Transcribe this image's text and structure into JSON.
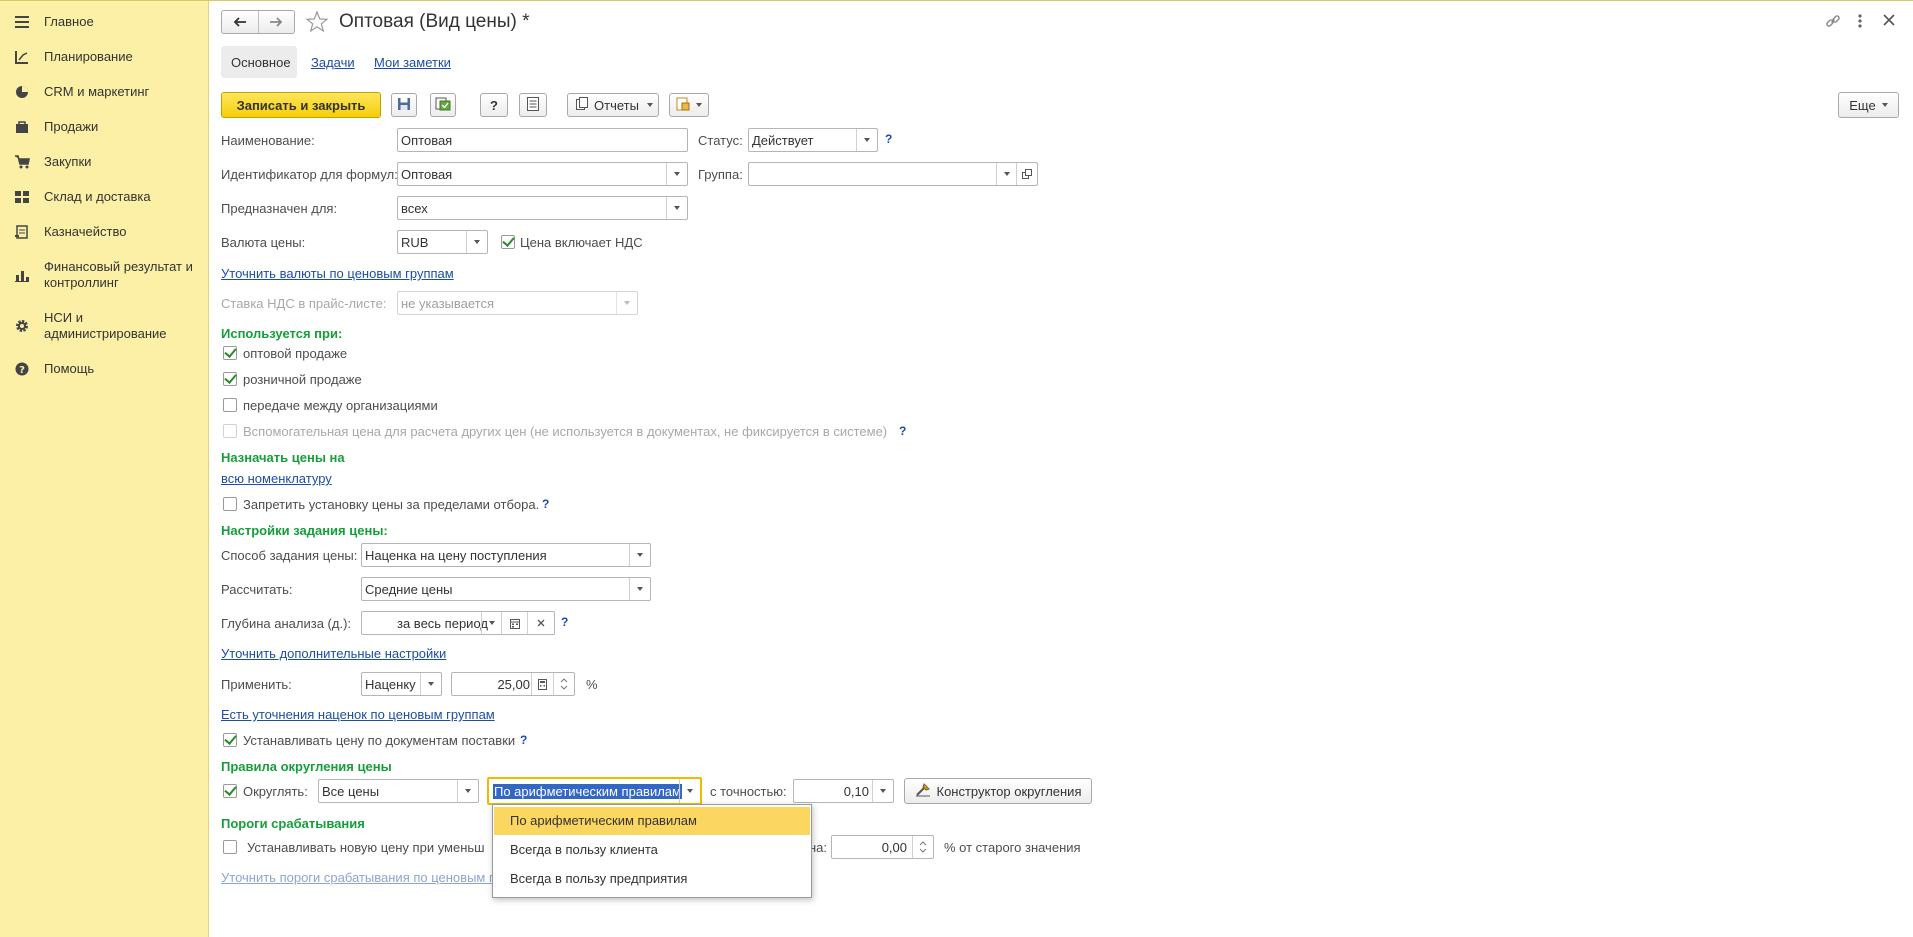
{
  "sidebar": {
    "items": [
      {
        "label": "Главное",
        "icon": "menu-icon"
      },
      {
        "label": "Планирование",
        "icon": "planning-icon"
      },
      {
        "label": "CRM и маркетинг",
        "icon": "pie-chart-icon"
      },
      {
        "label": "Продажи",
        "icon": "bag-icon"
      },
      {
        "label": "Закупки",
        "icon": "cart-icon"
      },
      {
        "label": "Склад и доставка",
        "icon": "warehouse-icon"
      },
      {
        "label": "Казначейство",
        "icon": "treasury-icon"
      },
      {
        "label": "Финансовый результат и контроллинг",
        "icon": "bar-chart-icon"
      },
      {
        "label": "НСИ и администрирование",
        "icon": "gear-icon"
      },
      {
        "label": "Помощь",
        "icon": "help-icon"
      }
    ]
  },
  "header": {
    "title": "Оптовая (Вид цены) *"
  },
  "tabs": [
    "Основное",
    "Задачи",
    "Мои заметки"
  ],
  "toolbar": {
    "save_close": "Записать и закрыть",
    "help": "?",
    "reports": "Отчеты",
    "more": "Еще"
  },
  "form": {
    "name_label": "Наименование:",
    "name_value": "Оптовая",
    "status_label": "Статус:",
    "status_value": "Действует",
    "formula_id_label": "Идентификатор для формул:",
    "formula_id_value": "Оптовая",
    "group_label": "Группа:",
    "group_value": "",
    "intended_label": "Предназначен для:",
    "intended_value": "всех",
    "currency_label": "Валюта цены:",
    "currency_value": "RUB",
    "vat_included_label": "Цена включает НДС",
    "vat_included": true,
    "currency_groups_link": "Уточнить валюты по ценовым группам",
    "vat_rate_label": "Ставка НДС в прайс-листе:",
    "vat_rate_value": "не указывается",
    "used_header": "Используется при:",
    "used_wholesale": "оптовой продаже",
    "used_wholesale_checked": true,
    "used_retail": "розничной продаже",
    "used_retail_checked": true,
    "used_transfer": "передаче между организациями",
    "used_transfer_checked": false,
    "used_aux": "Вспомогательная цена для расчета других цен (не используется в документах, не фиксируется в системе)",
    "used_aux_checked": false,
    "assign_header": "Назначать цены на",
    "assign_link": "всю номенклатуру",
    "forbid_label": "Запретить установку цены за пределами отбора.",
    "forbid_checked": false,
    "settings_header": "Настройки задания цены:",
    "method_label": "Способ задания цены:",
    "method_value": "Наценка на цену поступления",
    "calc_label": "Рассчитать:",
    "calc_value": "Средние цены",
    "depth_label": "Глубина анализа (д.):",
    "depth_value": "за весь период",
    "extra_settings_link": "Уточнить дополнительные настройки",
    "apply_label": "Применить:",
    "apply_value": "Наценку",
    "apply_amount": "25,00",
    "percent_sign": "%",
    "markup_groups_link": "Есть уточнения наценок по ценовым группам",
    "set_by_docs_label": "Устанавливать цену по документам поставки",
    "set_by_docs_checked": true,
    "rounding_header": "Правила округления цены",
    "round_label": "Округлять:",
    "round_checked": true,
    "round_scope_value": "Все цены",
    "round_method_value": "По арифметическим правилам",
    "precision_label": "с точностью:",
    "precision_value": "0,10",
    "constructor_button": "Конструктор округления",
    "thresholds_header": "Пороги срабатывания",
    "threshold_label_start": "Устанавливать новую цену при уменьш",
    "threshold_label_end": "на:",
    "threshold_checked": false,
    "threshold_value": "0,00",
    "threshold_suffix": "% от старого значения",
    "thresholds_link": "Уточнить пороги срабатывания по ценовым г"
  },
  "dropdown": {
    "options": [
      "По арифметическим правилам",
      "Всегда в пользу клиента",
      "Всегда в пользу предприятия"
    ],
    "selected_index": 0
  }
}
